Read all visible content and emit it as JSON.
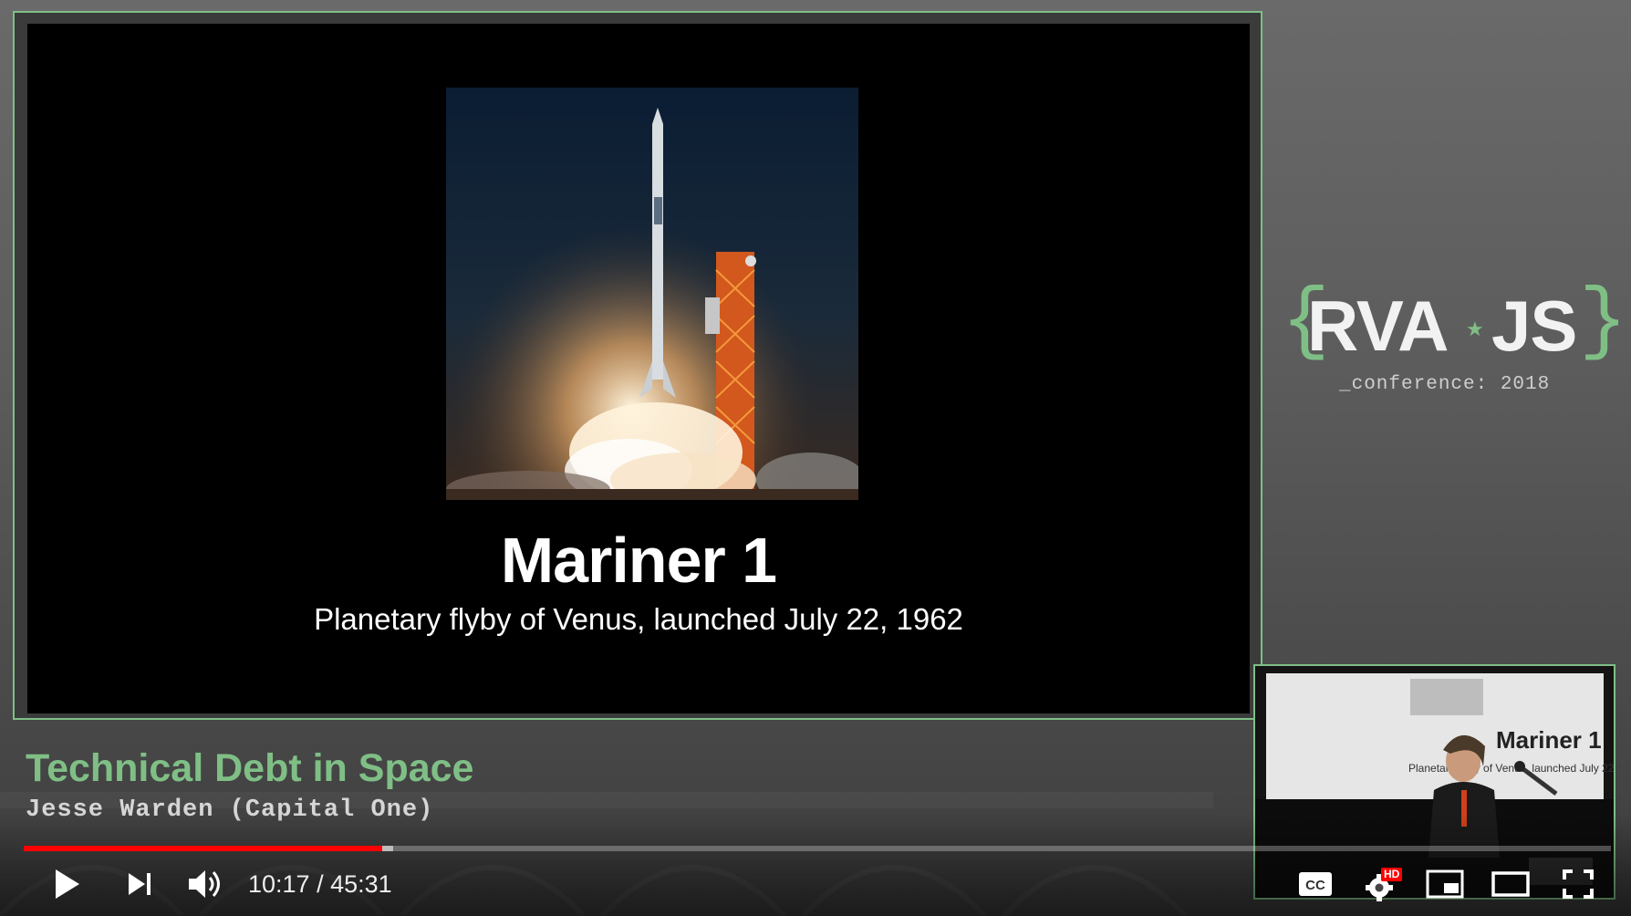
{
  "slide": {
    "title": "Mariner 1",
    "subtitle": "Planetary flyby of Venus, launched July 22, 1962"
  },
  "branding": {
    "brace_open": "{",
    "brace_close": "}",
    "word_left": "RVA",
    "word_right": "JS",
    "star": "★",
    "conference": "_conference: 2018"
  },
  "talk": {
    "title": "Technical Debt in Space",
    "speaker": "Jesse Warden (Capital One)"
  },
  "player": {
    "current_time": "10:17",
    "separator": " / ",
    "duration": "45:31",
    "progress_fraction": 0.226,
    "hd_badge": "HD",
    "accent": "#ff0000",
    "brand_green": "#7fbf86"
  },
  "icons": [
    "play-icon",
    "next-icon",
    "volume-icon",
    "captions-icon",
    "settings-icon",
    "miniplayer-icon",
    "theater-icon",
    "fullscreen-icon"
  ]
}
